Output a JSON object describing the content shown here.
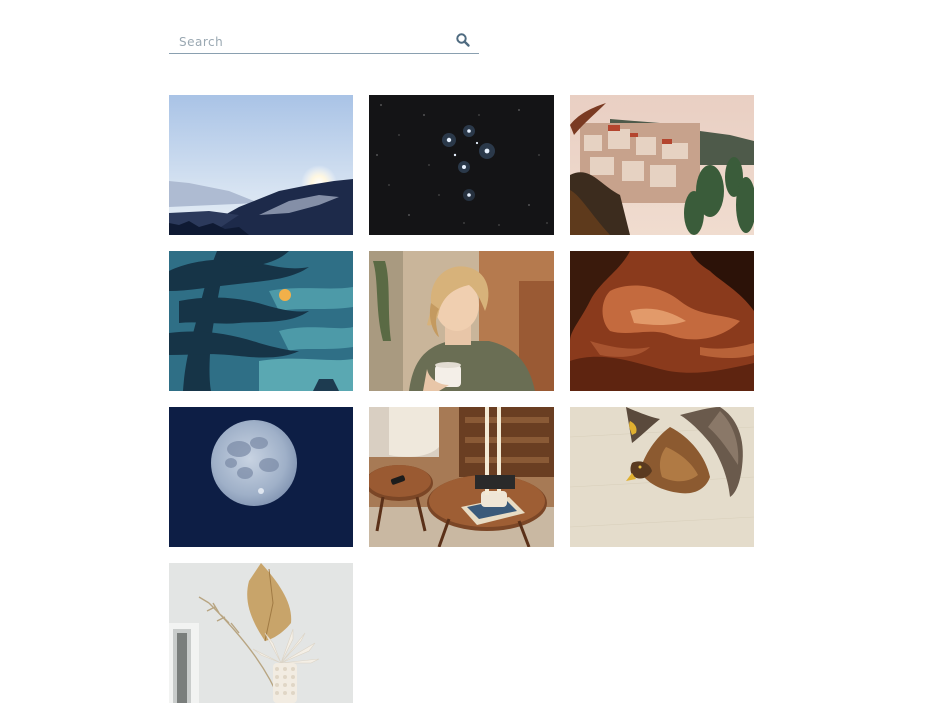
{
  "search": {
    "placeholder": "Search",
    "value": "",
    "icon": "search-icon"
  },
  "gallery": {
    "items": [
      {
        "subject": "mountain-sunrise"
      },
      {
        "subject": "star-cluster"
      },
      {
        "subject": "coastal-town-cactus"
      },
      {
        "subject": "woodblock-pine-moon"
      },
      {
        "subject": "woman-with-mug"
      },
      {
        "subject": "abstract-rust-marble"
      },
      {
        "subject": "full-moon"
      },
      {
        "subject": "wooden-coffee-tables"
      },
      {
        "subject": "hawk-painting"
      },
      {
        "subject": "dried-palm-vase"
      }
    ]
  }
}
